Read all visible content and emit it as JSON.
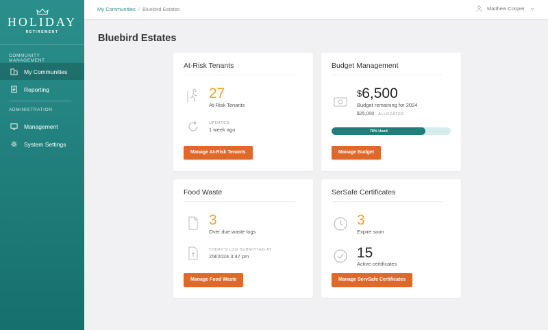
{
  "sidebar": {
    "brand": "HOLIDAY",
    "brand_sub": "RETIREMENT",
    "section1": "COMMUNITY MANAGEMENT",
    "section2": "ADMINISTRATION",
    "items": [
      {
        "label": "My Communities",
        "icon": "building-icon"
      },
      {
        "label": "Reporting",
        "icon": "report-icon"
      },
      {
        "label": "Management",
        "icon": "monitor-icon"
      },
      {
        "label": "System Settings",
        "icon": "gear-icon"
      }
    ]
  },
  "header": {
    "breadcrumb": [
      "My Communities",
      "Bluebird Estates"
    ],
    "separator": "/",
    "user": "Matthew Cooper"
  },
  "page": {
    "title": "Bluebird Estates"
  },
  "cards": {
    "tenants": {
      "title": "At-Risk Tenants",
      "count": "27",
      "count_label": "At-Risk Tenants",
      "updated_label": "UPDATED",
      "updated_value": "1 week ago",
      "button": "Manage At-Risk Tenants"
    },
    "budget": {
      "title": "Budget Management",
      "currency": "$",
      "amount": "6,500",
      "remaining_label": "Budget remaining for 2024",
      "allocated_value": "$25,000",
      "allocated_label": "ALLOCATED",
      "used_percent": 79,
      "used_label": "79% Used",
      "button": "Manage Budget"
    },
    "food": {
      "title": "Food Waste",
      "count": "3",
      "count_label": "Over due waste logs",
      "log_label": "TODAY'S LOG SUBMITTED AT",
      "log_value": "2/8/2024 3:47 pm",
      "button": "Manage Food Waste"
    },
    "certs": {
      "title": "SerSafe Certificates",
      "expire_count": "3",
      "expire_label": "Expire soon",
      "active_count": "15",
      "active_label": "Active certificates",
      "button": "Manage ServSafe Certificates"
    }
  },
  "colors": {
    "teal": "#1f7d7a",
    "orange": "#e0692a",
    "accent": "#f0a22e"
  }
}
